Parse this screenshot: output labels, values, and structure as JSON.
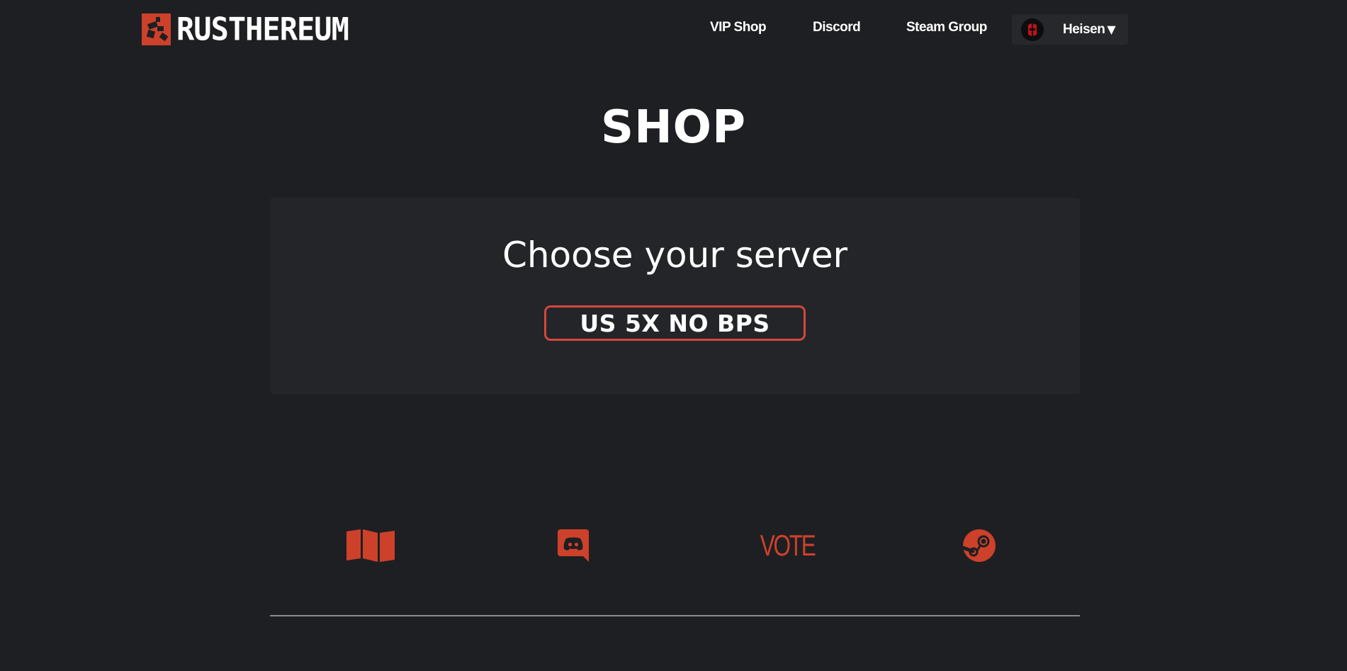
{
  "brand": {
    "name": "RUSTHEREUM"
  },
  "nav": {
    "links": [
      "VIP Shop",
      "Discord",
      "Steam Group"
    ],
    "user": {
      "name": "Heisen",
      "caret": "▼"
    }
  },
  "page": {
    "title": "SHOP",
    "panel_heading": "Choose your server",
    "server_option": "US 5X NO BPS"
  },
  "footer": {
    "icons": [
      "map-icon",
      "discord-icon",
      "vote-link",
      "steam-icon"
    ],
    "vote_label": "VOTE"
  },
  "colors": {
    "background": "#1e1f22",
    "panel": "#232528",
    "accent": "#cd412b",
    "button_border": "#d4473d"
  }
}
